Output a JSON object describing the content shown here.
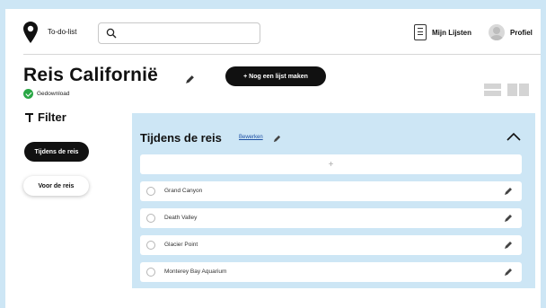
{
  "header": {
    "logo_text": "To-do-list",
    "search_placeholder": "",
    "lists_label": "Mijn Lijsten",
    "profile_label": "Profiel"
  },
  "page": {
    "title": "Reis Californië",
    "status": "Gedownload",
    "new_list_button": "+ Nog een lijst maken"
  },
  "filter": {
    "heading": "Filter",
    "options": [
      "Tijdens de reis",
      "Voor de reis"
    ],
    "active_index": 0
  },
  "panel": {
    "title": "Tijdens de reis",
    "edit_link": "Bewerken",
    "add_symbol": "+",
    "items": [
      "Grand Canyon",
      "Death Valley",
      "Glacier Point",
      "Monterey Bay Aquarium"
    ]
  },
  "icons": {
    "logo": "location-pin-icon",
    "search": "search-icon",
    "lists": "list-document-icon",
    "edit": "pencil-icon",
    "collapse": "chevron-up-icon",
    "status": "check-circle-icon"
  },
  "colors": {
    "background": "#cde6f5",
    "panel": "#cde6f5",
    "primary_button": "#111111",
    "status_green": "#29a745",
    "link": "#1d4fa3"
  }
}
